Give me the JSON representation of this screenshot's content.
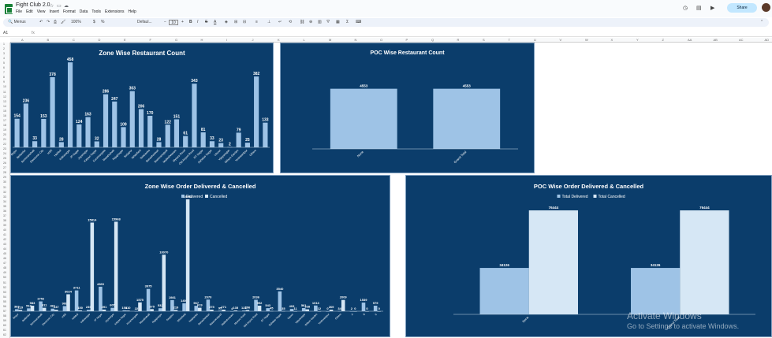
{
  "app": {
    "doc_title": "Fight Club 2.0",
    "menus": [
      "File",
      "Edit",
      "View",
      "Insert",
      "Format",
      "Data",
      "Tools",
      "Extensions",
      "Help"
    ],
    "share_label": "Share"
  },
  "toolbar": {
    "search_label": "Menus",
    "zoom": "100%",
    "currency": "$",
    "percent": "%",
    "font": "Defaul...",
    "font_size": "10"
  },
  "formula_bar": {
    "name_box": "A1",
    "fx": "fx"
  },
  "grid": {
    "columns": [
      "A",
      "B",
      "C",
      "D",
      "E",
      "F",
      "G",
      "H",
      "I",
      "J",
      "K",
      "L",
      "M",
      "N",
      "O",
      "P",
      "Q",
      "R",
      "S",
      "T",
      "U",
      "V",
      "W",
      "X",
      "Y",
      "Z",
      "AA",
      "AB",
      "AC",
      "AD"
    ],
    "rows": [
      "1",
      "2",
      "3",
      "4",
      "5",
      "6",
      "7",
      "8",
      "9",
      "10",
      "11",
      "12",
      "13",
      "14",
      "15",
      "16",
      "17",
      "18",
      "19",
      "20",
      "21",
      "22",
      "23",
      "24",
      "25",
      "26",
      "27",
      "28",
      "29",
      "30",
      "31",
      "32",
      "33",
      "34",
      "35",
      "36",
      "37",
      "38",
      "39",
      "40",
      "41",
      "42",
      "43",
      "44",
      "45",
      "46",
      "47",
      "48",
      "49",
      "50",
      "51",
      "52",
      "53",
      "54",
      "55",
      "56",
      "57",
      "58",
      "59",
      "60",
      "61",
      "62"
    ]
  },
  "colors": {
    "panel": "#0b3d6b",
    "bar_dark": "#9ec3e6",
    "bar_light": "#d6e7f5",
    "text": "#ffffff"
  },
  "watermark": {
    "line1": "Activate Windows",
    "line2": "Go to Settings to activate Windows."
  },
  "chart_data": [
    {
      "type": "bar",
      "title": "Zone Wise Restaurant Count",
      "categories": [
        "Begur",
        "Bellandur",
        "Bommanahalli",
        "Electronic City",
        "HSR",
        "Hebbal",
        "Indiranagar",
        "JP Nagar",
        "Jayanagar",
        "Kalyan Nagar",
        "Koramangala",
        "Marathahalli",
        "Rajajinagar",
        "Sarjapur",
        "Whitefield",
        "Yelahanka",
        "Banashankari",
        "Basavanagudi",
        "Malleshwaram",
        "Mysore Road",
        "Old Airport Road",
        "RT Nagar",
        "Sahakar Nagar",
        "Ulsoor",
        "Vijayanagar",
        "Wilson Garden",
        "Yeshwantpur",
        "Others"
      ],
      "values": [
        154,
        236,
        33,
        153,
        378,
        28,
        458,
        124,
        163,
        32,
        286,
        247,
        109,
        303,
        206,
        170,
        28,
        122,
        151,
        61,
        343,
        81,
        33,
        23,
        2,
        79,
        25,
        382,
        133
      ]
    },
    {
      "type": "bar",
      "title": "POC Wise Restaurant Count",
      "categories": [
        "None",
        "Grand Total"
      ],
      "values": [
        4553,
        4553
      ]
    },
    {
      "type": "bar",
      "title": "Zone Wise Order Delivered & Cancelled",
      "legend": [
        "Delivered",
        "Cancelled"
      ],
      "series": [
        {
          "name": "Delivered",
          "values": [
            363,
            513,
            1752,
            461,
            909,
            3711,
            249,
            4369,
            605,
            158,
            22,
            3975,
            532,
            1981,
            1409,
            967,
            2070,
            95,
            4,
            123,
            2036,
            543,
            3540,
            403,
            561,
            1013,
            0,
            34,
            2,
            1539,
            979
          ]
        },
        {
          "name": "Cancelled",
          "values": [
            219,
            983,
            611,
            247,
            3024,
            150,
            15814,
            291,
            15968,
            110,
            1575,
            375,
            10070,
            219,
            19962,
            619,
            275,
            271,
            135,
            206,
            992,
            45,
            35,
            11,
            338,
            12,
            269,
            2009,
            0,
            0,
            0
          ]
        }
      ],
      "categories": [
        "Begur",
        "Bellandur",
        "Bommanahalli",
        "Electronic City",
        "HSR",
        "Hebbal",
        "Indiranagar",
        "JP Nagar",
        "Jayanagar",
        "Kalyan Nagar",
        "Koramangala",
        "Marathahalli",
        "Rajajinagar",
        "Sarjapur",
        "Whitefield",
        "Yelahanka",
        "Banashankari",
        "Basavanagudi",
        "Malleshwaram",
        "Mysore Road",
        "Old Airport Road",
        "RT Nagar",
        "Sahakar Nagar",
        "Ulsoor",
        "Vijayanagar",
        "Wilson Garden",
        "Yeshwantpur",
        "Others",
        "A",
        "B",
        "C"
      ]
    },
    {
      "type": "bar",
      "title": "POC Wise Order Delivered & Cancelled",
      "legend": [
        "Total Delivered",
        "Total Cancelled"
      ],
      "categories": [
        "None",
        "Grand Total"
      ],
      "series": [
        {
          "name": "Total Delivered",
          "values": [
            34126,
            34126
          ]
        },
        {
          "name": "Total Cancelled",
          "values": [
            76444,
            76444
          ]
        }
      ]
    }
  ]
}
